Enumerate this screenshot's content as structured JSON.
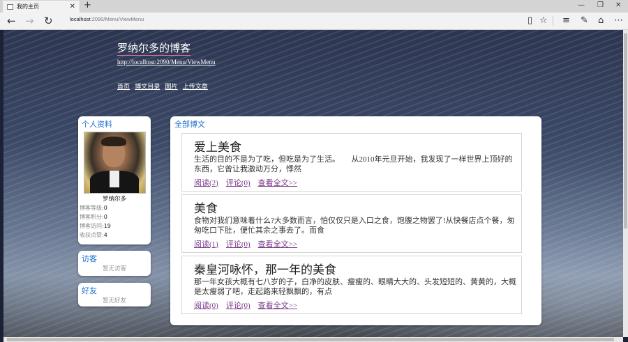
{
  "browser": {
    "tab_title": "我的主页",
    "address_host": "localhost",
    "address_path": ":2090/Menu/ViewMenu",
    "new_tab_glyph": "+",
    "close_glyph": "✕",
    "icons": [
      "back-arrow-icon",
      "forward-arrow-icon",
      "refresh-icon",
      "reading-view-icon",
      "favorite-star-icon",
      "hub-icon",
      "web-note-icon",
      "share-icon",
      "more-icon"
    ]
  },
  "blog": {
    "title": "罗纳尔多的博客",
    "url": "http://localhost:2090/Menu/ViewMenu",
    "menu": [
      "首页",
      "博文目录",
      "图片",
      "上传文章"
    ]
  },
  "sidebar": {
    "profile_title": "个人资料",
    "username": "罗纳尔多",
    "stats": [
      {
        "label": "博客等级:",
        "value": "0"
      },
      {
        "label": "博客积分:",
        "value": "0"
      },
      {
        "label": "博客访问:",
        "value": "19"
      },
      {
        "label": "收获点赞:",
        "value": "4"
      }
    ],
    "visitors_title": "访客",
    "visitors_empty": "暂无访客",
    "friends_title": "好友",
    "friends_empty": "暂无好友"
  },
  "main": {
    "title": "全部博文",
    "posts": [
      {
        "title": "爱上美食",
        "summary": "生活的目的不是为了吃，但吃是为了生活。　　从2010年元旦开始，我发现了一样世界上顶好的东西，它曾让我激动万分，悸然",
        "read": "阅读(2)",
        "comment": "评论(0)",
        "more": "查看全文>>"
      },
      {
        "title": "美食",
        "summary": "食物对我们意味着什么?大多数而言，怕仅仅只是入口之食，饱腹之物罢了!从快餐店点个餐，匆匆吃口下肚，便忙其余之事去了。而食",
        "read": "阅读(1)",
        "comment": "评论(0)",
        "more": "查看全文>>"
      },
      {
        "title": "秦皇河咏怀，那一年的美食",
        "summary": "那一年女孩大概有七八岁的子，白净的皮肤、瘦瘦的、眼睛大大的、头发短短的、黄黄的，大概是太瘦弱了吧，走起路来轻飘飘的，有点",
        "read": "阅读(0)",
        "comment": "评论(0)",
        "more": "查看全文>>"
      }
    ]
  }
}
